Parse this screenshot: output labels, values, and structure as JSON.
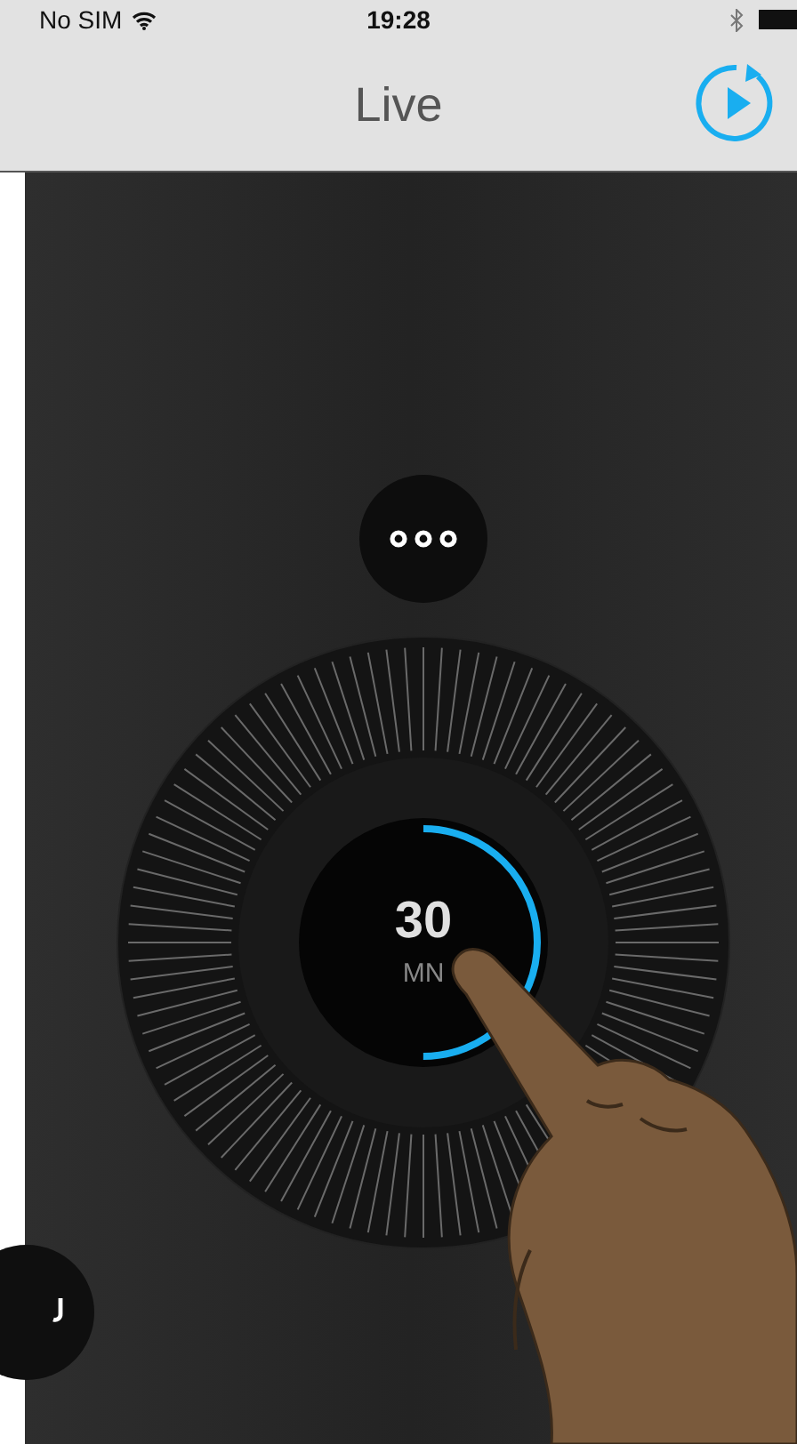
{
  "status_bar": {
    "carrier": "No SIM",
    "time": "19:28"
  },
  "nav_bar": {
    "title": "Live"
  },
  "timer": {
    "value": "30",
    "unit": "MN",
    "level": 0.5
  }
}
